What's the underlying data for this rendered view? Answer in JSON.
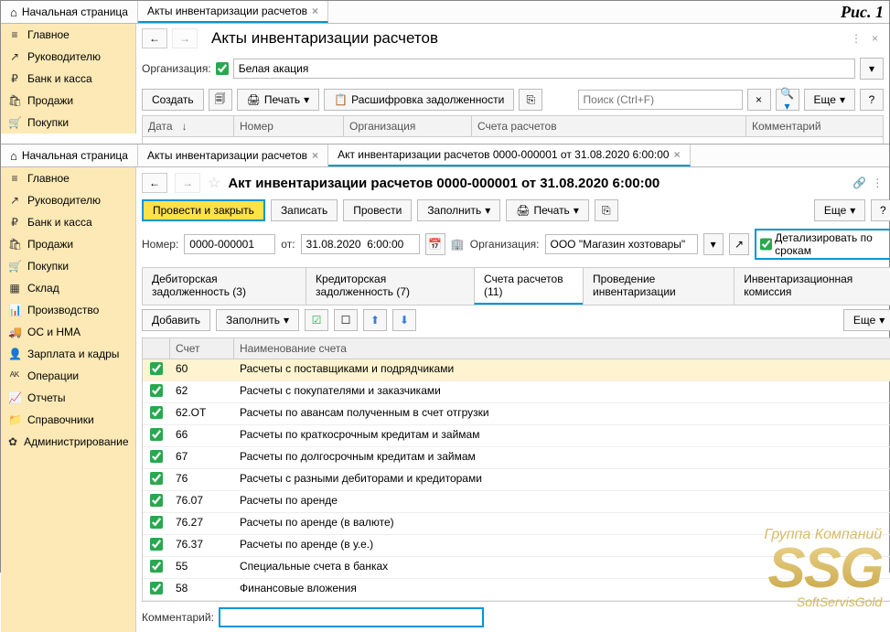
{
  "fig_label": "Рис. 1",
  "top1": {
    "tabs": [
      {
        "label": "Начальная страница",
        "home": true
      },
      {
        "label": "Акты инвентаризации расчетов",
        "active": true,
        "closable": true
      }
    ],
    "page_title": "Акты инвентаризации расчетов",
    "org_label": "Организация:",
    "org_value": "Белая акация",
    "create_btn": "Создать",
    "print_btn": "Печать",
    "detail_btn": "Расшифровка задолженности",
    "search_placeholder": "Поиск (Ctrl+F)",
    "more_btn": "Еще",
    "columns": {
      "date": "Дата",
      "number": "Номер",
      "org": "Организация",
      "accounts": "Счета расчетов",
      "comment": "Комментарий"
    }
  },
  "sidebar_top": [
    {
      "icon": "≡",
      "label": "Главное"
    },
    {
      "icon": "↗",
      "label": "Руководителю"
    },
    {
      "icon": "₽",
      "label": "Банк и касса"
    },
    {
      "icon": "🛍",
      "label": "Продажи"
    },
    {
      "icon": "🛒",
      "label": "Покупки"
    }
  ],
  "top2": {
    "tabs": [
      {
        "label": "Начальная страница",
        "home": true
      },
      {
        "label": "Акты инвентаризации расчетов",
        "closable": true
      },
      {
        "label": "Акт инвентаризации расчетов 0000-000001 от 31.08.2020 6:00:00",
        "active": true,
        "closable": true
      }
    ]
  },
  "sidebar2": [
    {
      "icon": "≡",
      "label": "Главное"
    },
    {
      "icon": "↗",
      "label": "Руководителю"
    },
    {
      "icon": "₽",
      "label": "Банк и касса"
    },
    {
      "icon": "🛍",
      "label": "Продажи"
    },
    {
      "icon": "🛒",
      "label": "Покупки"
    },
    {
      "icon": "▦",
      "label": "Склад"
    },
    {
      "icon": "📊",
      "label": "Производство"
    },
    {
      "icon": "🚚",
      "label": "ОС и НМА"
    },
    {
      "icon": "👤",
      "label": "Зарплата и кадры"
    },
    {
      "icon": "ᴬᴷ",
      "label": "Операции"
    },
    {
      "icon": "📈",
      "label": "Отчеты"
    },
    {
      "icon": "📁",
      "label": "Справочники"
    },
    {
      "icon": "✿",
      "label": "Администрирование"
    }
  ],
  "doc": {
    "title": "Акт инвентаризации расчетов 0000-000001 от 31.08.2020 6:00:00",
    "post_close": "Провести и закрыть",
    "save": "Записать",
    "post": "Провести",
    "fill": "Заполнить",
    "print": "Печать",
    "more": "Еще",
    "number_label": "Номер:",
    "number": "0000-000001",
    "from_label": "от:",
    "date": "31.08.2020  6:00:00",
    "org_label": "Организация:",
    "org": "ООО \"Магазин хозтовары\"",
    "detail_by_terms": "Детализировать по срокам",
    "tabs": [
      {
        "label": "Дебиторская задолженность (3)"
      },
      {
        "label": "Кредиторская задолженность (7)"
      },
      {
        "label": "Счета расчетов (11)",
        "active": true
      },
      {
        "label": "Проведение инвентаризации"
      },
      {
        "label": "Инвентаризационная комиссия"
      }
    ],
    "add_btn": "Добавить",
    "fill_btn": "Заполнить",
    "grid_cols": {
      "acct": "Счет",
      "name": "Наименование счета"
    },
    "accounts": [
      {
        "chk": true,
        "acct": "60",
        "name": "Расчеты с поставщиками и подрядчиками",
        "sel": true
      },
      {
        "chk": true,
        "acct": "62",
        "name": "Расчеты с покупателями и заказчиками"
      },
      {
        "chk": true,
        "acct": "62.ОТ",
        "name": "Расчеты по авансам полученным в счет отгрузки"
      },
      {
        "chk": true,
        "acct": "66",
        "name": "Расчеты по краткосрочным кредитам и займам"
      },
      {
        "chk": true,
        "acct": "67",
        "name": "Расчеты по долгосрочным кредитам и займам"
      },
      {
        "chk": true,
        "acct": "76",
        "name": "Расчеты с разными дебиторами и кредиторами"
      },
      {
        "chk": true,
        "acct": "76.07",
        "name": "Расчеты по аренде"
      },
      {
        "chk": true,
        "acct": "76.27",
        "name": "Расчеты по аренде (в валюте)"
      },
      {
        "chk": true,
        "acct": "76.37",
        "name": "Расчеты по аренде (в у.е.)"
      },
      {
        "chk": true,
        "acct": "55",
        "name": "Специальные счета в банках"
      },
      {
        "chk": true,
        "acct": "58",
        "name": "Финансовые вложения"
      }
    ],
    "comment_label": "Комментарий:"
  },
  "watermark": {
    "line1": "Группа Компаний",
    "line2": "SSG",
    "line3": "SoftServisGold"
  }
}
